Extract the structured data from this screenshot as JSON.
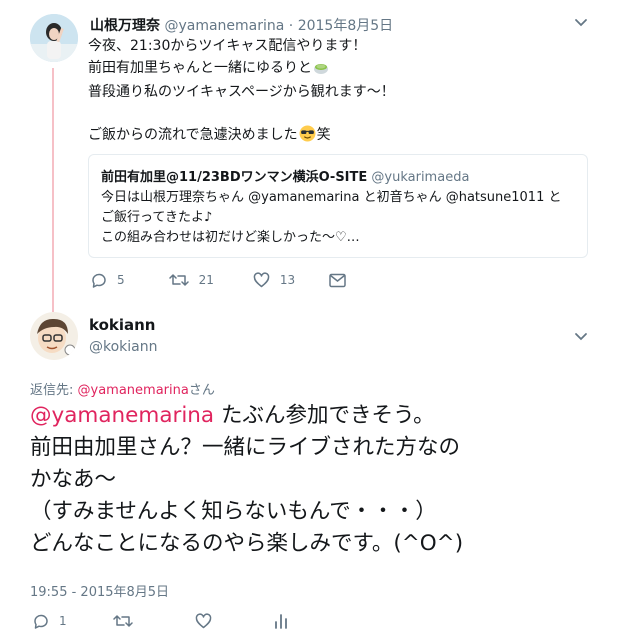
{
  "tweet1": {
    "name": "山根万理奈",
    "handle": "@yamanemarina",
    "sep": "·",
    "date": "2015年8月5日",
    "lines": [
      "今夜、21:30からツイキャス配信やります！",
      "前田有加里ちゃんと一緒にゆるりと",
      "普段通り私のツイキャスページから観れます〜！",
      "",
      "ご飯からの流れで急遽決めました",
      "笑"
    ],
    "quote": {
      "name": "前田有加里@11/23BDワンマン横浜O-SITE",
      "handle": "@yukarimaeda",
      "lines": [
        "今日は山根万理奈ちゃん @yamanemarina と初音ちゃん @hatsune1011 と",
        "ご飯行ってきたよ♪",
        "この組み合わせは初だけど楽しかった〜♡…"
      ]
    },
    "stats": {
      "replies": "5",
      "retweets": "21",
      "likes": "13"
    }
  },
  "tweet2": {
    "name": "kokiann",
    "handle": "@kokiann",
    "reply_prefix": "返信先: ",
    "reply_to": "@yamanemarina",
    "reply_suffix": "さん",
    "mention": "@yamanemarina",
    "lines": [
      " たぶん参加できそう。",
      "前田由加里さん？一緒にライブされた方なの",
      "かなあ〜",
      "（すみませんよく知らないもんで・・・）",
      "どんなことになるのやら楽しみです。(^O^)"
    ],
    "timestamp": "19:55 - 2015年8月5日",
    "stats": {
      "replies": "1"
    }
  },
  "colors": {
    "accent": "#e0245e",
    "muted": "#657786",
    "thread": "#f6c0c7",
    "border": "#e6ecf0"
  },
  "icons": [
    "chevron-down-icon",
    "reply-icon",
    "retweet-icon",
    "like-icon",
    "message-icon",
    "analytics-icon",
    "matcha-emoji-icon",
    "sunglasses-emoji-icon"
  ]
}
